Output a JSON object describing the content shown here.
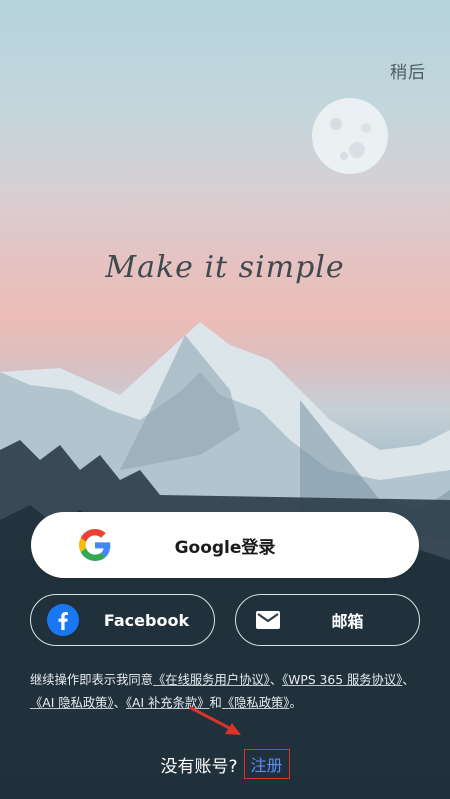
{
  "header": {
    "later_label": "稍后"
  },
  "hero": {
    "tagline": "Make it simple"
  },
  "login": {
    "google_label": "Google登录",
    "facebook_label": "Facebook",
    "email_label": "邮箱"
  },
  "agreement": {
    "prefix": "继续操作即表示我同意",
    "links": [
      "《在线服务用户协议》",
      "《WPS 365 服务协议》",
      "《AI 隐私政策》",
      "《AI 补充条款》",
      "《隐私政策》"
    ],
    "sep1": "、",
    "sep2": "、",
    "sep3": "、",
    "and": "和",
    "suffix": "。"
  },
  "signup": {
    "question": "没有账号?",
    "link_label": "注册"
  },
  "colors": {
    "link": "#5d8cf2",
    "highlight_box": "#d9342b",
    "facebook": "#1877f2"
  }
}
